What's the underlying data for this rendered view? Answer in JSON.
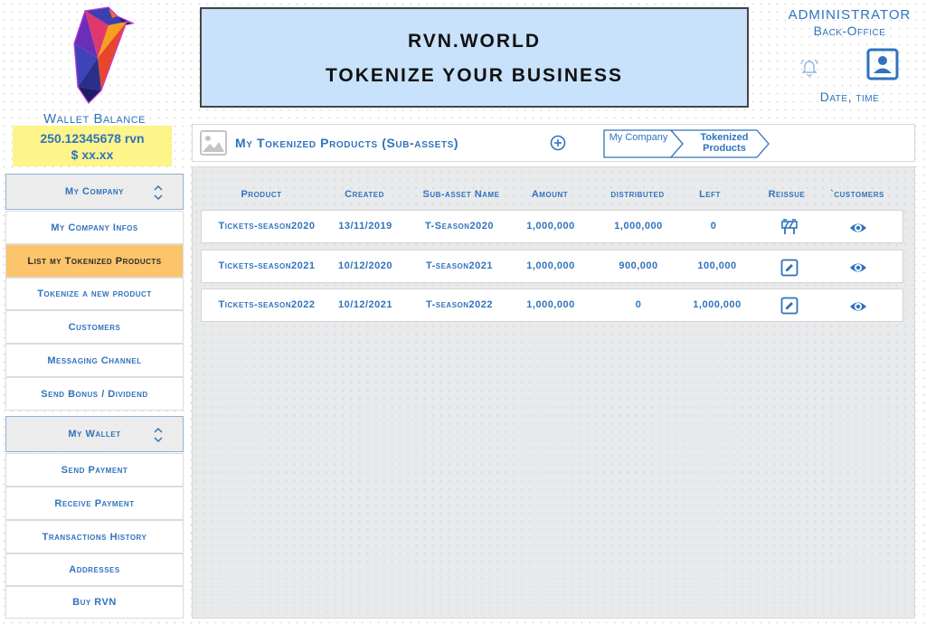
{
  "wallet": {
    "title": "Wallet Balance",
    "balance": "250.12345678 rvn",
    "fiat": "$ xx.xx"
  },
  "sidebar": {
    "company_section": "My Company",
    "company_items": [
      "My Company Infos",
      "List my Tokenized Products",
      "Tokenize a new product",
      "Customers",
      "Messaging Channel",
      "Send Bonus / Dividend"
    ],
    "wallet_section": "My Wallet",
    "wallet_items": [
      "Send Payment",
      "Receive Payment",
      "Transactions History",
      "Addresses",
      "Buy RVN"
    ]
  },
  "banner": {
    "line1": "RVN.WORLD",
    "line2": "TOKENIZE YOUR BUSINESS"
  },
  "admin": {
    "title": "ADMINISTRATOR",
    "subtitle": "Back-Office",
    "date_time": "Date, time"
  },
  "page": {
    "title": "My Tokenized Products (Sub-assets)",
    "breadcrumb": [
      "My Company",
      "Tokenized Products"
    ]
  },
  "table": {
    "columns": [
      "Product",
      "Created",
      "Sub-asset Name",
      "Amount",
      "distributed",
      "Left",
      "Reissue",
      "`customers"
    ],
    "rows": [
      {
        "product": "Tickets-season2020",
        "created": "13/11/2019",
        "subasset": "T-Season2020",
        "amount": "1,000,000",
        "distributed": "1,000,000",
        "left": "0",
        "reissue_icon": "barrier-icon",
        "customers_icon": "eye-icon"
      },
      {
        "product": "Tickets-season2021",
        "created": "10/12/2020",
        "subasset": "T-season2021",
        "amount": "1,000,000",
        "distributed": "900,000",
        "left": "100,000",
        "reissue_icon": "edit-icon",
        "customers_icon": "eye-icon"
      },
      {
        "product": "Tickets-season2022",
        "created": "10/12/2021",
        "subasset": "T-season2022",
        "amount": "1,000,000",
        "distributed": "0",
        "left": "1,000,000",
        "reissue_icon": "edit-icon",
        "customers_icon": "eye-icon"
      }
    ]
  },
  "colors": {
    "accent": "#2f73bd",
    "banner_bg": "#c8e2fb",
    "wallet_bg": "#fdf48a",
    "active_item_bg": "#fcc56b"
  }
}
